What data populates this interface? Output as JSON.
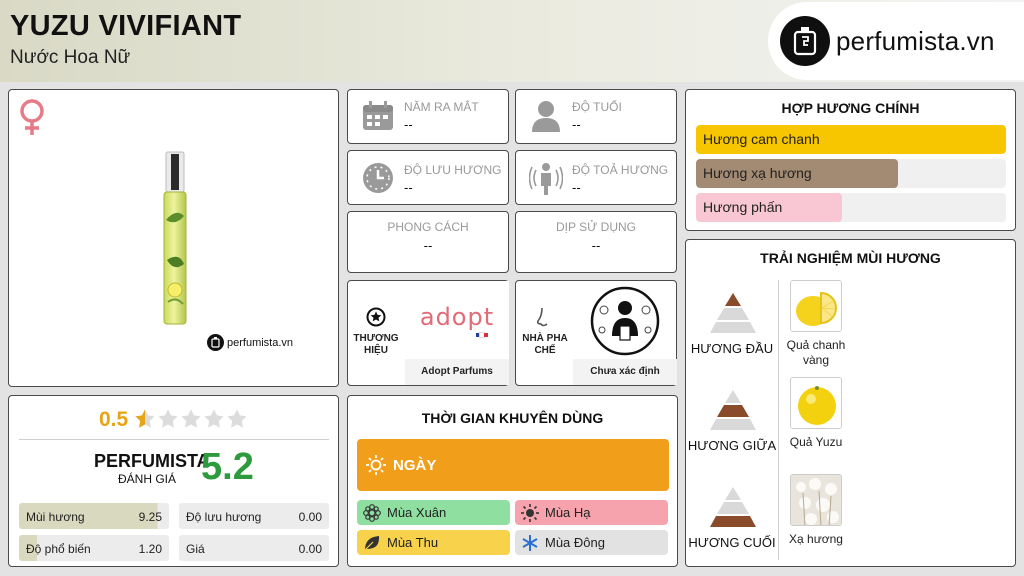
{
  "header": {
    "title": "YUZU VIVIFIANT",
    "subtitle": "Nước Hoa Nữ",
    "logo_text": "perfumista.vn"
  },
  "product": {
    "gender_icon": "female-symbol-icon",
    "watermark": "perfumista.vn"
  },
  "info": {
    "release_label": "NĂM RA MẮT",
    "release_value": "--",
    "age_label": "ĐỘ TUỔI",
    "age_value": "--",
    "longevity_label": "ĐỘ LƯU HƯƠNG",
    "longevity_value": "--",
    "sillage_label": "ĐỘ TOẢ HƯƠNG",
    "sillage_value": "--",
    "style_label": "PHONG CÁCH",
    "style_value": "--",
    "occasion_label": "DỊP SỬ DỤNG",
    "occasion_value": "--",
    "brand_label": "THƯƠNG HIỆU",
    "brand_name": "Adopt Parfums",
    "brand_logo": "adopt",
    "perfumer_label": "NHÀ PHA CHẾ",
    "perfumer_name": "Chưa xác định"
  },
  "accords": {
    "title": "HỢP HƯƠNG CHÍNH",
    "items": [
      {
        "label": "Hương cam chanh",
        "level": 1.0,
        "color": "#f7c600"
      },
      {
        "label": "Hương xạ hương",
        "level": 0.65,
        "color": "#a38a72"
      },
      {
        "label": "Hương phấn",
        "level": 0.47,
        "color": "#f8c7d3"
      }
    ]
  },
  "rating": {
    "user_score": "0.5",
    "stars_filled": 0.5,
    "stars_total": 5,
    "brand_label": "PERFUMISTA",
    "brand_sub": "ĐÁNH GIÁ",
    "perfumista_score": "5.2",
    "stats": [
      {
        "label": "Mùi hương",
        "value": "9.25",
        "level": 0.925
      },
      {
        "label": "Độ lưu hương",
        "value": "0.00",
        "level": 0
      },
      {
        "label": "Độ phổ biến",
        "value": "1.20",
        "level": 0.12
      },
      {
        "label": "Giá",
        "value": "0.00",
        "level": 0
      }
    ]
  },
  "timing": {
    "title": "THỜI GIAN KHUYÊN DÙNG",
    "day_label": "NGÀY",
    "seasons": [
      {
        "label": "Mùa Xuân",
        "color": "#8fe0a0",
        "icon": "spring-flower-icon"
      },
      {
        "label": "Mùa Hạ",
        "color": "#f7a3ad",
        "icon": "summer-sun-icon"
      },
      {
        "label": "Mùa Thu",
        "color": "#f7d24a",
        "icon": "autumn-leaf-icon"
      },
      {
        "label": "Mùa Đông",
        "color": "#e2e2e2",
        "icon": "winter-snowflake-icon"
      }
    ]
  },
  "notes": {
    "title": "TRẢI NGHIỆM MÙI HƯƠNG",
    "tiers": [
      {
        "label": "HƯƠNG ĐẦU",
        "items": [
          {
            "name": "Quả chanh vàng",
            "image": "lemon"
          }
        ]
      },
      {
        "label": "HƯƠNG GIỮA",
        "items": [
          {
            "name": "Quả Yuzu",
            "image": "yuzu"
          }
        ]
      },
      {
        "label": "HƯƠNG CUỐI",
        "items": [
          {
            "name": "Xạ hương",
            "image": "musk"
          }
        ]
      }
    ]
  }
}
